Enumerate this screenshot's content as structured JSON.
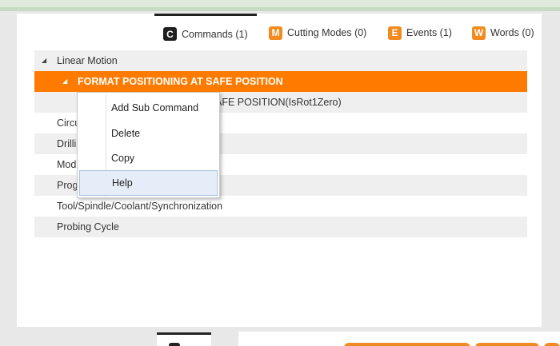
{
  "tabs": [
    {
      "letter": "C",
      "label": "Commands (1)",
      "color": "#1e1e1e",
      "active": true
    },
    {
      "letter": "M",
      "label": "Cutting Modes (0)",
      "color": "#f28a1e",
      "active": false
    },
    {
      "letter": "E",
      "label": "Events (1)",
      "color": "#f28a1e",
      "active": false
    },
    {
      "letter": "W",
      "label": "Words (0)",
      "color": "#f28a1e",
      "active": false
    }
  ],
  "tree": {
    "linear_motion": "Linear Motion",
    "format_positioning": "FORMAT POSITIONING AT SAFE POSITION",
    "child_command_visible": "AFE POSITION(IsRot1Zero)",
    "circular_partial": "Circu",
    "drilling_partial": "Drilli",
    "modal_partial": "Mod",
    "program_partial": "Prog",
    "tool_spindle": "Tool/Spindle/Coolant/Synchronization",
    "probing_cycle": "Probing Cycle"
  },
  "context_menu": {
    "add_sub_command": "Add Sub Command",
    "delete": "Delete",
    "copy": "Copy",
    "help": "Help"
  },
  "colors": {
    "selection": "#ff7b00",
    "accent_orange": "#f28a1e",
    "alt_row": "#efefef",
    "menu_hover": "#e5eef8"
  }
}
